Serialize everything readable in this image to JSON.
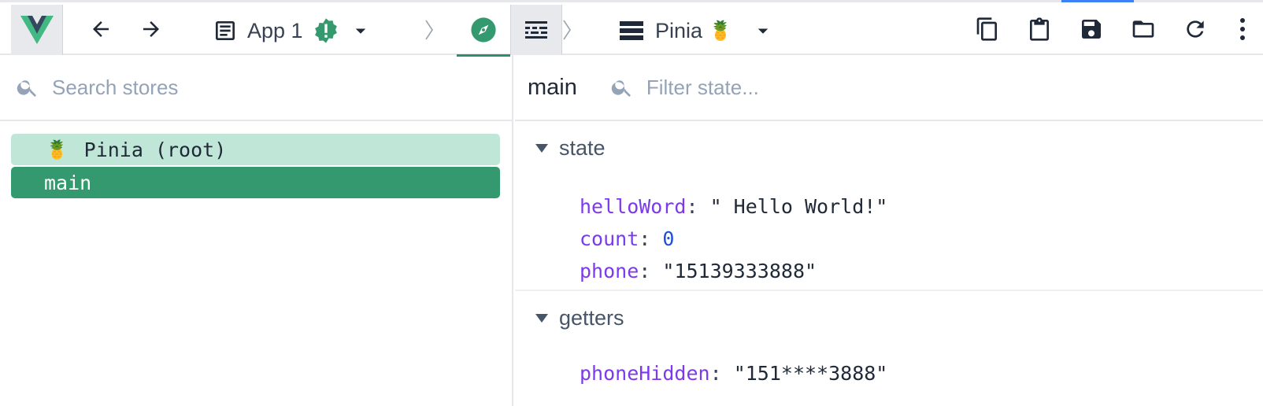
{
  "toolbar": {
    "app_name": "App 1",
    "store_name": "Pinia",
    "store_emoji": "🍍",
    "logo_icon": "vue-logo-icon",
    "icons": [
      "back-arrow-icon",
      "forward-arrow-icon",
      "app-icon",
      "warning-badge-icon",
      "dropdown-caret-icon",
      "compass-icon",
      "timeline-icon",
      "stores-list-icon",
      "copy-icon",
      "clipboard-icon",
      "save-icon",
      "folder-icon",
      "refresh-icon",
      "more-vert-icon"
    ]
  },
  "left": {
    "search_placeholder": "Search stores",
    "items": [
      {
        "emoji": "🍍",
        "label": "Pinia (root)"
      },
      {
        "label": "main"
      }
    ]
  },
  "right": {
    "store_title": "main",
    "filter_placeholder": "Filter state...",
    "sections": {
      "state": {
        "title": "state",
        "props": [
          {
            "key": "helloWord",
            "value": "\" Hello World!\""
          },
          {
            "key": "count",
            "value": "0"
          },
          {
            "key": "phone",
            "value": "\"15139333888\""
          }
        ]
      },
      "getters": {
        "title": "getters",
        "props": [
          {
            "key": "phoneHidden",
            "value": "\"151****3888\""
          }
        ]
      }
    }
  },
  "colors": {
    "accent": "#34996f",
    "accent_light": "#c0e6d8",
    "key": "#7c3aed",
    "number": "#1d4ed8"
  }
}
